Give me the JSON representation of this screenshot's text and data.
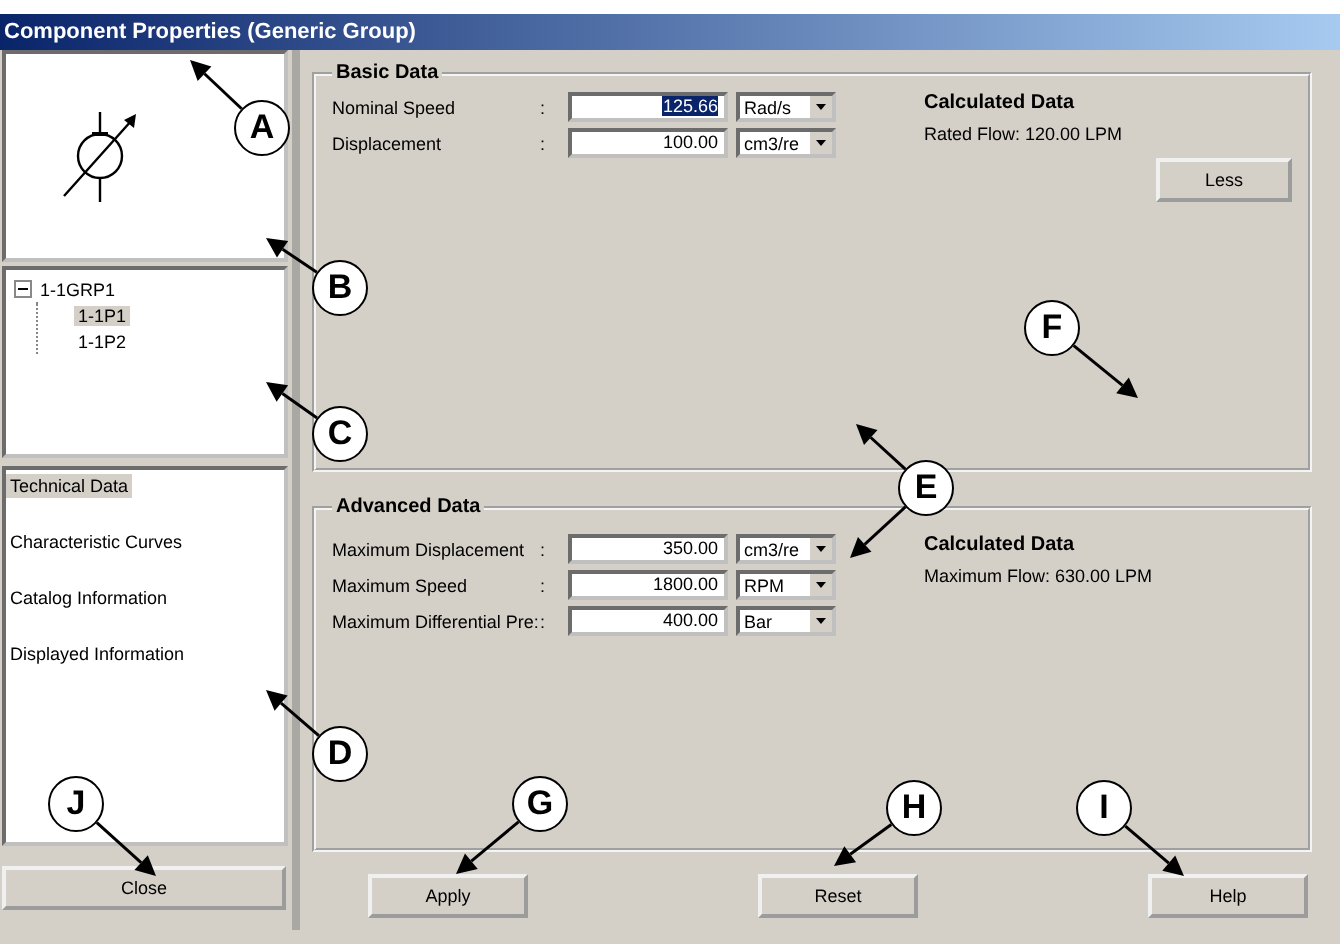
{
  "window": {
    "title": "Component Properties (Generic Group)"
  },
  "tree": [
    {
      "label": "1-1GRP1",
      "expanded": true,
      "selected": false,
      "children": [
        {
          "label": "1-1P1",
          "selected": true
        },
        {
          "label": "1-1P2",
          "selected": false
        }
      ]
    }
  ],
  "pages": [
    {
      "label": "Technical Data",
      "selected": true
    },
    {
      "label": "Characteristic Curves",
      "selected": false
    },
    {
      "label": "Catalog Information",
      "selected": false
    },
    {
      "label": "Displayed Information",
      "selected": false
    }
  ],
  "close_button": "Close",
  "basic_data": {
    "title": "Basic Data",
    "fields": [
      {
        "label": "Nominal Speed",
        "colon": ":",
        "value": "125.66",
        "highlighted": true,
        "unit": "Rad/s"
      },
      {
        "label": "Displacement",
        "colon": ":",
        "value": "100.00",
        "highlighted": false,
        "unit": "cm3/re"
      }
    ],
    "calculated_title": "Calculated Data",
    "calculated": "Rated Flow: 120.00 LPM",
    "button": "Less"
  },
  "advanced_data": {
    "title": "Advanced Data",
    "fields": [
      {
        "label": "Maximum Displacement",
        "colon": ":",
        "value": "350.00",
        "highlighted": false,
        "unit": "cm3/re"
      },
      {
        "label": "Maximum Speed",
        "colon": ":",
        "value": "1800.00",
        "highlighted": false,
        "unit": "RPM"
      },
      {
        "label": "Maximum Differential Pre:",
        "colon": ":",
        "value": "400.00",
        "highlighted": false,
        "unit": "Bar"
      }
    ],
    "calculated_title": "Calculated Data",
    "calculated": "Maximum Flow: 630.00 LPM"
  },
  "buttons": [
    "Apply",
    "Reset",
    "Help"
  ],
  "callouts": [
    {
      "letter": "A"
    },
    {
      "letter": "B"
    },
    {
      "letter": "F"
    },
    {
      "letter": "C"
    },
    {
      "letter": "E"
    },
    {
      "letter": "D"
    },
    {
      "letter": "J"
    },
    {
      "letter": "G"
    },
    {
      "letter": "H"
    },
    {
      "letter": "I"
    }
  ]
}
